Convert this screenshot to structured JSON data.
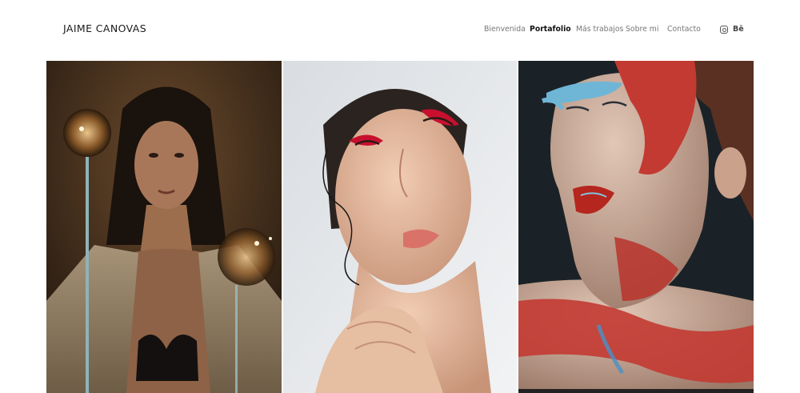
{
  "site": {
    "logo": "JAIME CANOVAS"
  },
  "nav": {
    "items": [
      {
        "label": "Bienvenida",
        "active": false
      },
      {
        "label": "Portafolio",
        "active": true
      },
      {
        "label": "Más trabajos",
        "active": false
      },
      {
        "label": "Sobre mi",
        "active": false
      },
      {
        "label": "Contacto",
        "active": false
      }
    ]
  },
  "social": {
    "instagram_icon": "instagram-icon",
    "behance_label": "Bē"
  },
  "gallery": {
    "photos": [
      {
        "name": "photo-woman-with-lamp",
        "palette": [
          "#2a1f16",
          "#8a6440",
          "#c7a078"
        ]
      },
      {
        "name": "photo-woman-red-makeup",
        "palette": [
          "#e4e7ea",
          "#e8c3ac",
          "#c8102e"
        ]
      },
      {
        "name": "photo-woman-red-blue-paint",
        "palette": [
          "#1c2228",
          "#c23a32",
          "#6fb6d6"
        ]
      }
    ]
  }
}
